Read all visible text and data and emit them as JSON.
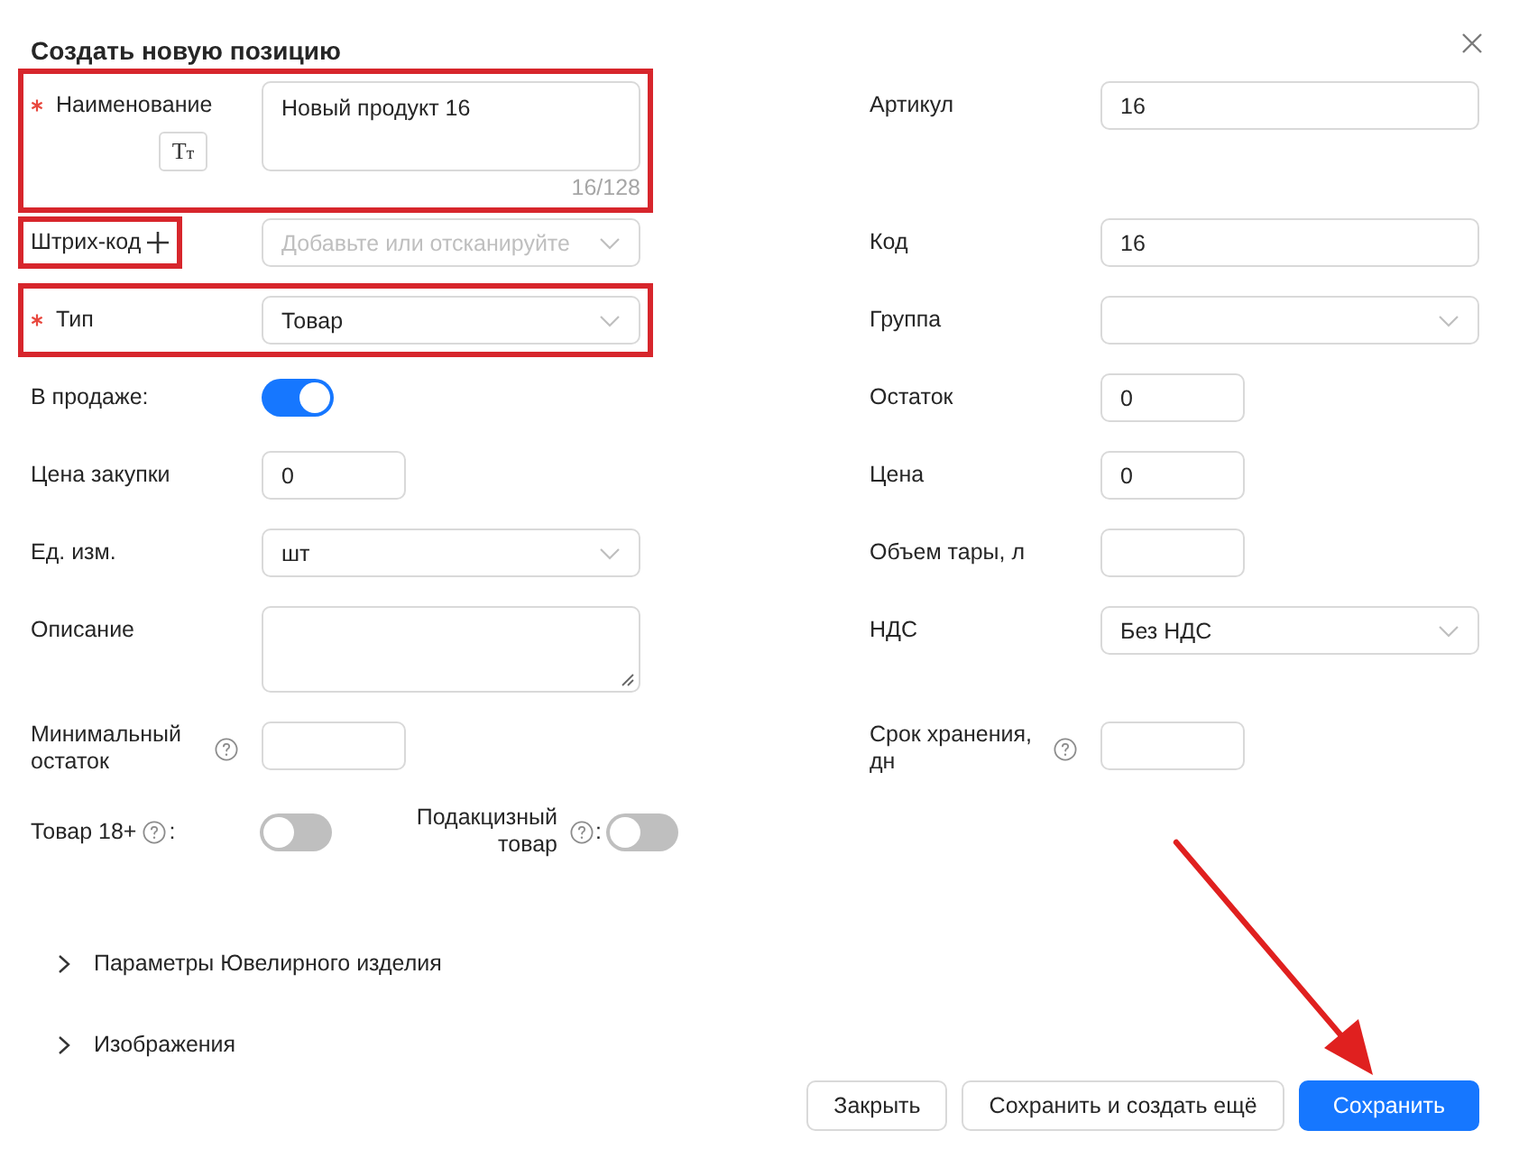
{
  "dialog": {
    "title": "Создать новую позицию"
  },
  "form_rows": [
    {
      "left": {
        "kind": "textarea",
        "label": "Наименование",
        "required": true,
        "format_button": "Tт",
        "value": "Новый продукт 16",
        "counter": "16/128",
        "resizable": false,
        "highlight_row": true
      },
      "right": {
        "kind": "text",
        "label": "Артикул",
        "value": "16"
      }
    },
    {
      "left": {
        "kind": "select",
        "label": "Штрих-код",
        "add": true,
        "placeholder": "Добавьте или отсканируйте",
        "highlight_label": true
      },
      "right": {
        "kind": "text",
        "label": "Код",
        "value": "16"
      }
    },
    {
      "left": {
        "kind": "select",
        "label": "Тип",
        "required": true,
        "value": "Товар",
        "highlight_row": true
      },
      "right": {
        "kind": "select",
        "label": "Группа"
      }
    },
    {
      "left": {
        "kind": "toggle",
        "label": "В продаже:",
        "on": true
      },
      "right": {
        "kind": "number",
        "label": "Остаток",
        "value": "0"
      }
    },
    {
      "left": {
        "kind": "number",
        "label": "Цена закупки",
        "value": "0"
      },
      "right": {
        "kind": "number",
        "label": "Цена",
        "value": "0"
      }
    },
    {
      "left": {
        "kind": "select",
        "label": "Ед. изм.",
        "value": "шт"
      },
      "right": {
        "kind": "number",
        "label": "Объем тары, л"
      }
    },
    {
      "left": {
        "kind": "textarea",
        "label": "Описание",
        "resizable": true
      },
      "right": {
        "kind": "select",
        "label": "НДС",
        "value": "Без НДС"
      }
    },
    {
      "left": {
        "kind": "number",
        "label": "Минимальный остаток",
        "help": true
      },
      "right": {
        "kind": "number",
        "label": "Срок хранения, дн",
        "help": true
      }
    },
    {
      "left": {
        "kind": "toggle_pair",
        "items": [
          {
            "label": "Товар 18+",
            "help": true,
            "suffix": ":",
            "on": false
          },
          {
            "label": "Подакцизный товар",
            "help": true,
            "suffix": ":",
            "on": false
          }
        ]
      }
    }
  ],
  "sections": [
    {
      "label": "Параметры Ювелирного изделия",
      "expanded": false
    },
    {
      "label": "Изображения",
      "expanded": false
    }
  ],
  "buttons": [
    {
      "label": "Закрыть",
      "primary": false
    },
    {
      "label": "Сохранить и создать ещё",
      "primary": false
    },
    {
      "label": "Сохранить",
      "primary": true
    }
  ],
  "annotation_arrow": true
}
